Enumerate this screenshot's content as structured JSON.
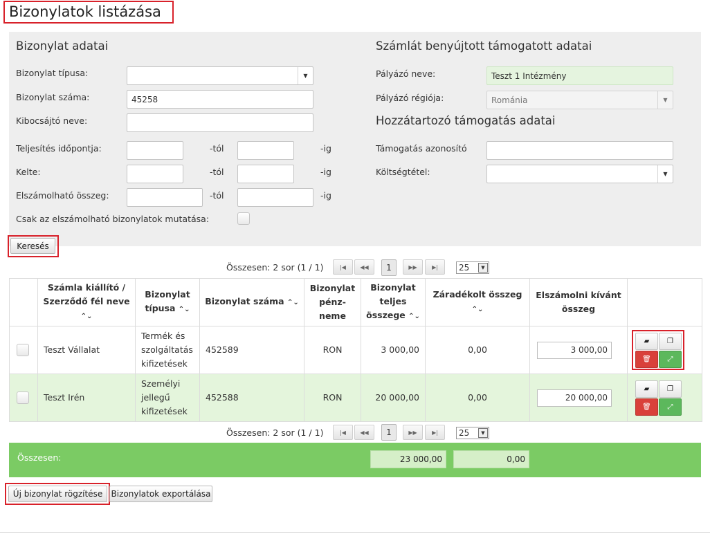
{
  "page": {
    "title": "Bizonylatok listázása"
  },
  "filter": {
    "left_title": "Bizonylat adatai",
    "right_title": "Számlát benyújtott támogatott adatai",
    "right_title2": "Hozzátartozó támogatás adatai",
    "type_label": "Bizonylat típusa:",
    "type_value": "",
    "number_label": "Bizonylat száma:",
    "number_value": "45258",
    "issuer_label": "Kibocsájtó neve:",
    "issuer_value": "",
    "perf_date_label": "Teljesítés időpontja:",
    "date_label": "Kelte:",
    "amount_label": "Elszámolható összeg:",
    "from_suffix": "-tól",
    "to_suffix": "-ig",
    "only_eligible_label": "Csak az elszámolható bizonylatok mutatása:",
    "applicant_name_label": "Pályázó neve:",
    "applicant_name_value": "Teszt 1 Intézmény",
    "applicant_region_label": "Pályázó régiója:",
    "applicant_region_value": "Románia",
    "support_id_label": "Támogatás azonosító",
    "support_id_value": "",
    "cost_item_label": "Költségtétel:",
    "cost_item_value": "",
    "search_button": "Keresés"
  },
  "pager": {
    "summary": "Összesen: 2 sor (1 / 1)",
    "current_page": "1",
    "per_page": "25",
    "first_icon": "first-page-icon",
    "prev_icon": "prev-page-icon",
    "next_icon": "next-page-icon",
    "last_icon": "last-page-icon"
  },
  "table": {
    "headers": {
      "issuer": "Számla kiállító / Szerződő fél neve",
      "type": "Bizonylat típusa",
      "number": "Bizonylat száma",
      "currency": "Bizonylat pénz-neme",
      "total": "Bizonylat teljes összege",
      "closed": "Záradékolt összeg",
      "claim": "Elszámolni kívánt összeg"
    },
    "sort_glyph": "⌃⌄",
    "rows": [
      {
        "issuer": "Teszt Vállalat",
        "type": "Termék és szolgáltatás kifizetések",
        "number": "452589",
        "currency": "RON",
        "total": "3 000,00",
        "closed": "0,00",
        "claim": "3 000,00"
      },
      {
        "issuer": "Teszt Irén",
        "type": "Személyi jellegű kifizetések",
        "number": "452588",
        "currency": "RON",
        "total": "20 000,00",
        "closed": "0,00",
        "claim": "20 000,00"
      }
    ],
    "actions": {
      "open_icon": "folder-open-icon",
      "copy_icon": "copy-icon",
      "delete_icon": "trash-icon",
      "expand_icon": "expand-icon"
    }
  },
  "summary": {
    "label": "Összesen:",
    "total": "23 000,00",
    "closed": "0,00"
  },
  "buttons": {
    "new_document": "Új bizonylat rögzítése",
    "export": "Bizonylatok exportálása"
  },
  "colors": {
    "highlight_border": "#d8212a",
    "summary_bar": "#7bcb64",
    "alt_row": "#e4f5dc",
    "panel": "#eeeeee"
  }
}
